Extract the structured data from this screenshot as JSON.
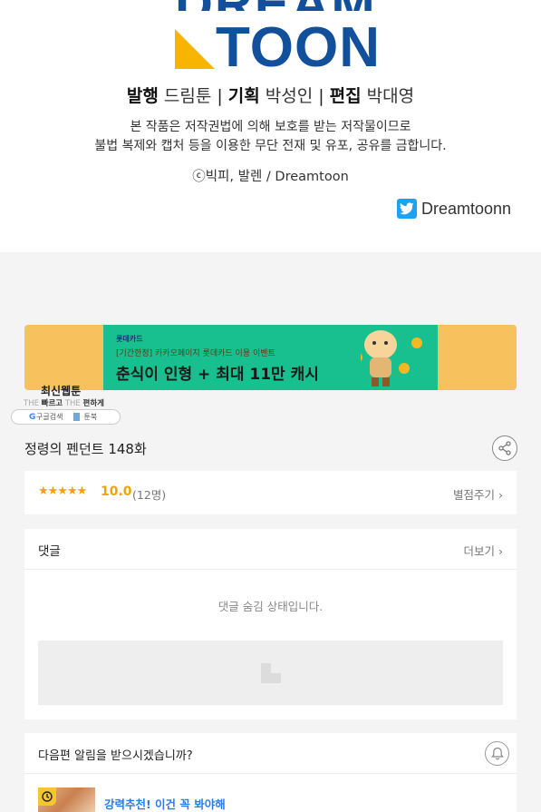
{
  "colors": {
    "brand_blue": "#12509c",
    "logo_yellow": "#f7b500",
    "star_orange": "#f2a20f",
    "banner_green": "#18c08f",
    "banner_yellow": "#f7c15e",
    "link_blue": "#2b7be4",
    "twitter_blue": "#1da1f2"
  },
  "credits": {
    "logo_top": "DREAM",
    "logo_bottom": "TOON",
    "publisher_label": "발행",
    "publisher_name": "드림툰",
    "planner_label": "기획",
    "planner_name": "박성인",
    "editor_label": "편집",
    "editor_name": "박대영",
    "separator": "|",
    "notice_line1": "본 작품은 저작권법에 의해 보호를 받는 저작물이므로",
    "notice_line2": "불법 복제와 캡처 등을 이용한 무단 전재 및 유포, 공유를 금합니다.",
    "copyright": "ⓒ빅피, 발렌 / Dreamtoon",
    "twitter_handle": "Dreamtoonn",
    "twitter_icon": "twitter-bird-icon"
  },
  "banner": {
    "brand": "롯데카드",
    "subtitle": "[기간한정] 카카오페이지 롯데카드 이용 이벤트",
    "headline": "춘식이 인형 + 최대 11만 캐시"
  },
  "badge": {
    "title": "최신웹툰",
    "sub_the1": "THE",
    "sub_fast": "빠르고",
    "sub_the2": "THE",
    "sub_comfy": "편하게",
    "google_g": "G",
    "search_label": "구글검색",
    "toonbook": "툰북"
  },
  "episode": {
    "title": "정령의 펜던트 148화",
    "share_icon": "share-icon"
  },
  "rating": {
    "stars": "★★★★★",
    "score": "10.0",
    "count": "(12명)",
    "give_label": "별점주기 ›"
  },
  "comments": {
    "label": "댓글",
    "more": "더보기 ›",
    "hidden_message": "댓글 숨김 상태입니다."
  },
  "notification": {
    "question": "다음편 알림을 받으시겠습니까?",
    "bell_icon": "bell-icon",
    "recommend_text": "강력추천! 이건 꼭 봐야해",
    "clock_icon": "clock-icon"
  }
}
